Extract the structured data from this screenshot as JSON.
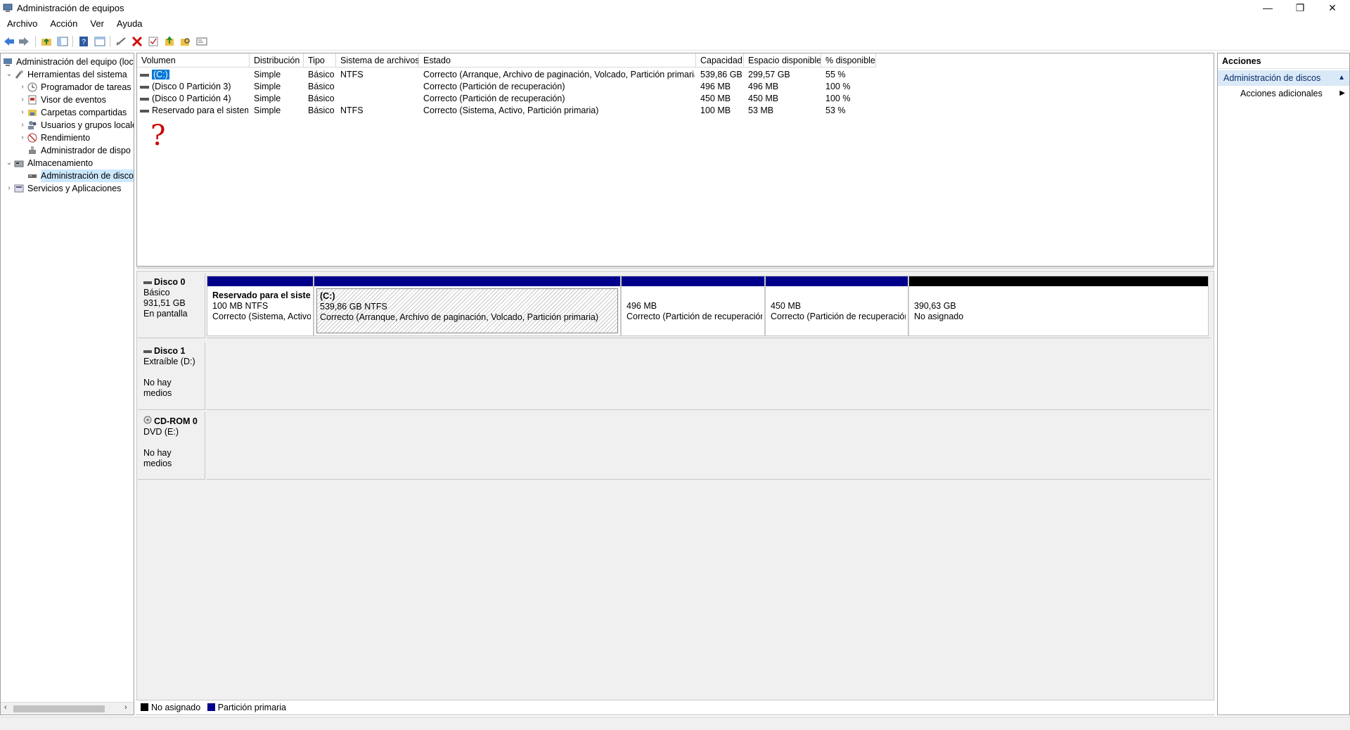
{
  "window": {
    "title": "Administración de equipos",
    "minimize": "—",
    "restore": "❐",
    "close": "✕"
  },
  "menu": [
    "Archivo",
    "Acción",
    "Ver",
    "Ayuda"
  ],
  "tree": {
    "root": "Administración del equipo (loc",
    "tools": "Herramientas del sistema",
    "scheduler": "Programador de tareas",
    "events": "Visor de eventos",
    "shared": "Carpetas compartidas",
    "users": "Usuarios y grupos locale",
    "perf": "Rendimiento",
    "devices": "Administrador de dispo",
    "storage": "Almacenamiento",
    "diskmgmt": "Administración de disco",
    "services": "Servicios y Aplicaciones"
  },
  "volumes": {
    "headers": [
      "Volumen",
      "Distribución",
      "Tipo",
      "Sistema de archivos",
      "Estado",
      "Capacidad",
      "Espacio disponible",
      "% disponible"
    ],
    "rows": [
      [
        "(C:)",
        "Simple",
        "Básico",
        "NTFS",
        "Correcto (Arranque, Archivo de paginación, Volcado, Partición primaria)",
        "539,86 GB",
        "299,57 GB",
        "55 %"
      ],
      [
        "(Disco 0 Partición 3)",
        "Simple",
        "Básico",
        "",
        "Correcto (Partición de recuperación)",
        "496 MB",
        "496 MB",
        "100 %"
      ],
      [
        "(Disco 0 Partición 4)",
        "Simple",
        "Básico",
        "",
        "Correcto (Partición de recuperación)",
        "450 MB",
        "450 MB",
        "100 %"
      ],
      [
        "Reservado para el sistema",
        "Simple",
        "Básico",
        "NTFS",
        "Correcto (Sistema, Activo, Partición primaria)",
        "100 MB",
        "53 MB",
        "53 %"
      ]
    ],
    "annotation": "?"
  },
  "disks": {
    "disk0": {
      "name": "Disco 0",
      "type": "Básico",
      "size": "931,51 GB",
      "state": "En pantalla",
      "partitions": [
        {
          "title": "Reservado para el sistem",
          "line1": "100 MB NTFS",
          "line2": "Correcto (Sistema, Activo,"
        },
        {
          "title": "(C:)",
          "line1": "539,86 GB NTFS",
          "line2": "Correcto (Arranque, Archivo de paginación, Volcado, Partición primaria)"
        },
        {
          "title": "",
          "line1": "496 MB",
          "line2": "Correcto (Partición de recuperación"
        },
        {
          "title": "",
          "line1": "450 MB",
          "line2": "Correcto (Partición de recuperación"
        },
        {
          "title": "",
          "line1": "390,63 GB",
          "line2": "No asignado"
        }
      ]
    },
    "disk1": {
      "name": "Disco 1",
      "type": "Extraíble (D:)",
      "state": "No hay medios"
    },
    "cdrom": {
      "name": "CD-ROM 0",
      "type": "DVD (E:)",
      "state": "No hay medios"
    }
  },
  "legend": {
    "unallocated": "No asignado",
    "primary": "Partición primaria"
  },
  "actions": {
    "header": "Acciones",
    "section": "Administración de discos",
    "more": "Acciones adicionales"
  },
  "colors": {
    "primary_partition": "#00008b",
    "unallocated": "#000000",
    "selection": "#0078d7",
    "action_section": "#d9e9f7"
  }
}
